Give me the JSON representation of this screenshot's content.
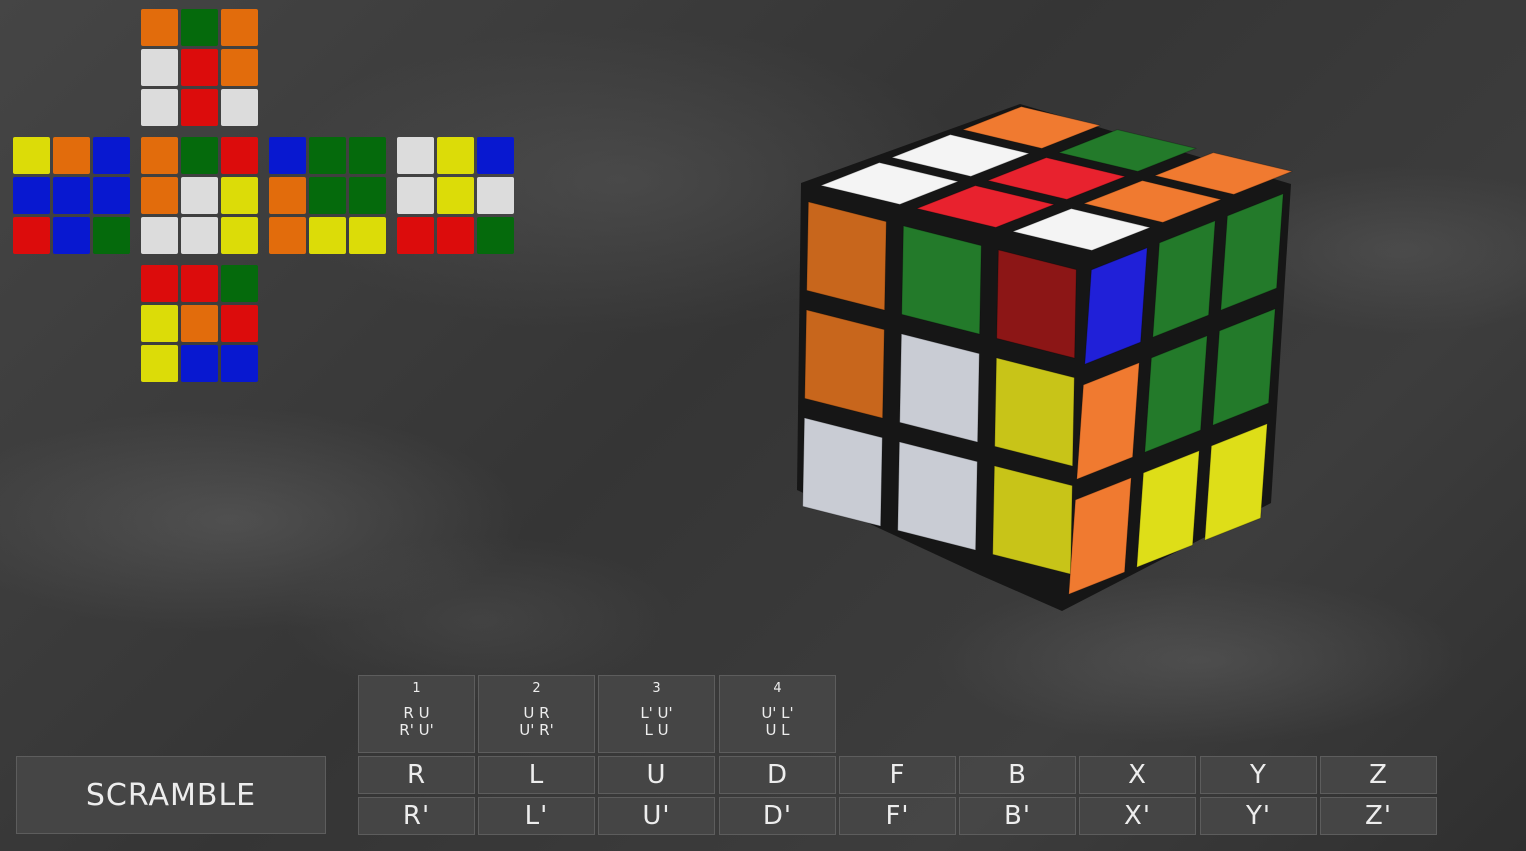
{
  "net": {
    "colors": {
      "o": "#e26c0c",
      "g": "#056a0c",
      "w": "#dcdcdc",
      "r": "#dc0c0c",
      "y": "#dcdc08",
      "b": "#0818d0"
    },
    "faces": [
      {
        "face": "top",
        "grid": [
          [
            "o",
            "g",
            "o"
          ],
          [
            "w",
            "r",
            "o"
          ],
          [
            "w",
            "r",
            "w"
          ]
        ]
      },
      {
        "face": "left",
        "grid": [
          [
            "y",
            "o",
            "b"
          ],
          [
            "b",
            "b",
            "b"
          ],
          [
            "r",
            "b",
            "g"
          ]
        ]
      },
      {
        "face": "front",
        "grid": [
          [
            "o",
            "g",
            "r"
          ],
          [
            "o",
            "w",
            "y"
          ],
          [
            "w",
            "w",
            "y"
          ]
        ]
      },
      {
        "face": "right",
        "grid": [
          [
            "b",
            "g",
            "g"
          ],
          [
            "o",
            "g",
            "g"
          ],
          [
            "o",
            "y",
            "y"
          ]
        ]
      },
      {
        "face": "back",
        "grid": [
          [
            "w",
            "y",
            "b"
          ],
          [
            "w",
            "y",
            "w"
          ],
          [
            "r",
            "r",
            "g"
          ]
        ]
      },
      {
        "face": "down",
        "grid": [
          [
            "r",
            "r",
            "g"
          ],
          [
            "y",
            "o",
            "r"
          ],
          [
            "y",
            "b",
            "b"
          ]
        ]
      }
    ]
  },
  "cube3d": {
    "colors": {
      "o": "#f07a30",
      "g": "#237a2a",
      "w": "#f4f4f4",
      "r": "#e8222e",
      "y": "#dede18",
      "b": "#2020d8",
      "gl": "#2a8a30",
      "ol": "#c8661c",
      "wl": "#c9ccd4",
      "yl": "#c8c418",
      "rl": "#8c1616"
    },
    "top": [
      [
        "o",
        "g",
        "o"
      ],
      [
        "w",
        "r",
        "o"
      ],
      [
        "w",
        "r",
        "w"
      ]
    ],
    "front": [
      [
        "ol",
        "g",
        "rl"
      ],
      [
        "ol",
        "wl",
        "yl"
      ],
      [
        "wl",
        "wl",
        "yl"
      ]
    ],
    "right": [
      [
        "b",
        "g",
        "g"
      ],
      [
        "o",
        "g",
        "g"
      ],
      [
        "o",
        "y",
        "y"
      ]
    ]
  },
  "controls": {
    "scramble_label": "SCRAMBLE",
    "algorithms": [
      {
        "num": "1",
        "line1": "R U",
        "line2": "R' U'"
      },
      {
        "num": "2",
        "line1": "U R",
        "line2": "U' R'"
      },
      {
        "num": "3",
        "line1": "L' U'",
        "line2": "L U"
      },
      {
        "num": "4",
        "line1": "U' L'",
        "line2": "U L"
      }
    ],
    "moves": [
      "R",
      "L",
      "U",
      "D",
      "F",
      "B",
      "X",
      "Y",
      "Z"
    ],
    "prime_moves": [
      "R'",
      "L'",
      "U'",
      "D'",
      "F'",
      "B'",
      "X'",
      "Y'",
      "Z'"
    ]
  }
}
